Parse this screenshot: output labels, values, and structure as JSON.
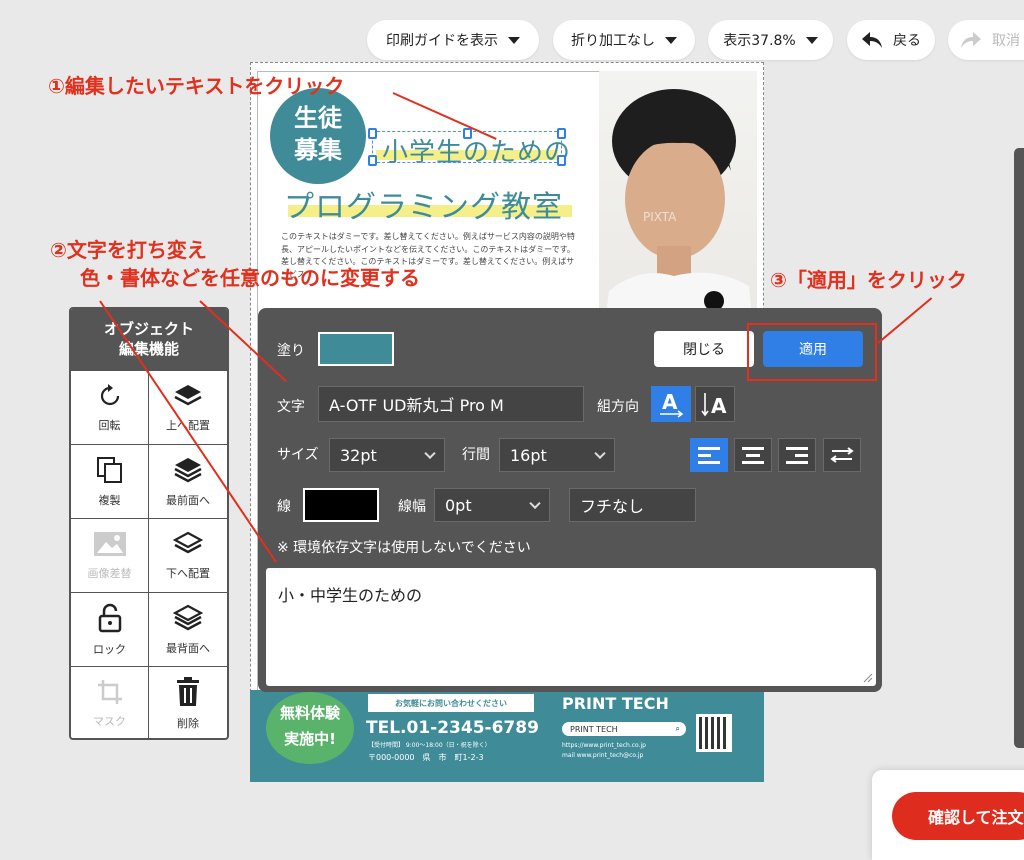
{
  "toolbar": {
    "print_guide": "印刷ガイドを表示",
    "fold": "折り加工なし",
    "zoom": "表示37.8%",
    "undo": "戻る",
    "redo": "取消"
  },
  "flyer": {
    "badge_line1": "生徒",
    "badge_line2": "募集",
    "headline1": "小学生のための",
    "headline2": "プログラミング教室",
    "body": "このテキストはダミーです。差し替えてください。例えばサービス内容の説明や特長、アピールしたいポイントなどを伝えてください。このテキストはダミーです。差し替えてください。このテキストはダミーです。差し替えてください。例えばサービス",
    "watermark": "PIXTA",
    "free_line1": "無料体験",
    "free_line2": "実施中!",
    "contact_banner": "お気軽にお問い合わせください",
    "tel": "TEL.01-2345-6789",
    "hours": "【受付時間】 9:00〜18:00（日・祝を除く）",
    "address": "〒000-0000　県　市　町1-2-3",
    "brand": "PRINT TECH",
    "search_text": "PRINT TECH",
    "url": "https://www.print_tech.co.jp",
    "mail": "mail  www.print_tech@co.jp"
  },
  "objpanel": {
    "title_line1": "オブジェクト",
    "title_line2": "編集機能",
    "items": [
      {
        "label": "回転",
        "icon": "rotate-icon",
        "enabled": true
      },
      {
        "label": "上へ配置",
        "icon": "layer-up-icon",
        "enabled": true
      },
      {
        "label": "複製",
        "icon": "duplicate-icon",
        "enabled": true
      },
      {
        "label": "最前面へ",
        "icon": "layer-front-icon",
        "enabled": true
      },
      {
        "label": "画像差替",
        "icon": "image-icon",
        "enabled": false
      },
      {
        "label": "下へ配置",
        "icon": "layer-down-icon",
        "enabled": true
      },
      {
        "label": "ロック",
        "icon": "lock-icon",
        "enabled": true
      },
      {
        "label": "最背面へ",
        "icon": "layer-back-icon",
        "enabled": true
      },
      {
        "label": "マスク",
        "icon": "crop-icon",
        "enabled": false
      },
      {
        "label": "削除",
        "icon": "trash-icon",
        "enabled": true
      }
    ]
  },
  "dialog": {
    "fill_label": "塗り",
    "fill_color": "#3f8c98",
    "close": "閉じる",
    "apply": "適用",
    "font_label": "文字",
    "font_value": "A-OTF UD新丸ゴ Pro M",
    "direction_label": "組方向",
    "size_label": "サイズ",
    "size_value": "32pt",
    "leading_label": "行間",
    "leading_value": "16pt",
    "stroke_label": "線",
    "stroke_color": "#000000",
    "stroke_width_label": "線幅",
    "stroke_width_value": "0pt",
    "outline_value": "フチなし",
    "warning": "※ 環境依存文字は使用しないでください",
    "text_value": "小・中学生のための",
    "accent": "#2f7fe6"
  },
  "annotations": {
    "step1": "①編集したいテキストをクリック",
    "step2_line1": "②文字を打ち変え",
    "step2_line2": "色・書体などを任意のものに変更する",
    "step3": "③「適用」をクリック",
    "color": "#e1301d"
  },
  "order": {
    "confirm": "確認して注文"
  }
}
